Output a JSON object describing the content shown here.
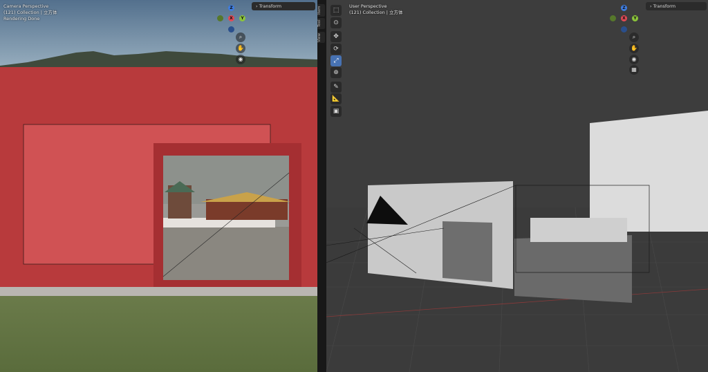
{
  "left_viewport": {
    "perspective_label": "Camera Perspective",
    "collection_label": "(121) Collection | 立方体",
    "status_label": "Rendering Done",
    "transform_panel_label": "Transform",
    "gizmo": {
      "z": "Z",
      "y": "Y",
      "x": "X"
    }
  },
  "side_tabs": [
    "Item",
    "Tool",
    "View"
  ],
  "right_viewport": {
    "perspective_label": "User Perspective",
    "collection_label": "(121) Collection | 立方体",
    "transform_panel_label": "Transform",
    "gizmo": {
      "z": "Z",
      "y": "Y",
      "x": "X"
    }
  },
  "colors": {
    "accent_active_tool": "#4772b3",
    "wall_red": "#b83a3c",
    "axis_x": "#e24a55",
    "axis_y": "#8bc43b",
    "axis_z": "#3f7de0"
  }
}
